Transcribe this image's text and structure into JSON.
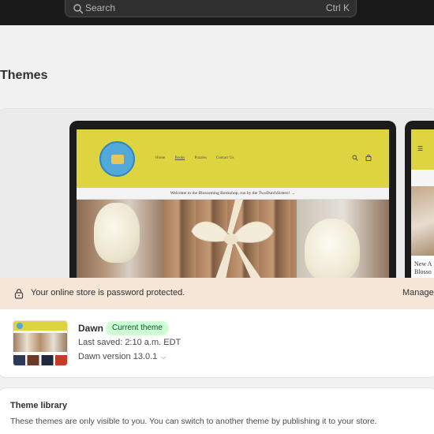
{
  "search": {
    "placeholder": "Search",
    "shortcut": "Ctrl K"
  },
  "page": {
    "title": "Themes"
  },
  "preview": {
    "desktop": {
      "nav": [
        "Home",
        "Books",
        "Puzzles",
        "Contact Us"
      ],
      "announcement": "Welcome to the Blossoming Bookshop, run by the TwoDutchSisters! →"
    },
    "mobile": {
      "text_line1": "New A",
      "text_line2": "Blosso"
    }
  },
  "banner": {
    "message": "Your online store is password protected.",
    "action": "Manage"
  },
  "current_theme": {
    "name": "Dawn",
    "badge": "Current theme",
    "last_saved": "Last saved: 2:10 a.m. EDT",
    "version": "Dawn version 13.0.1"
  },
  "library": {
    "title": "Theme library",
    "description": "These themes are only visible to you. You can switch to another theme by publishing it to your store."
  },
  "colors": {
    "store_header": "#ddd43f",
    "badge_bg": "#cdfed4",
    "banner_bg": "#f5e6d8",
    "topbar": "#1a1a1a"
  }
}
